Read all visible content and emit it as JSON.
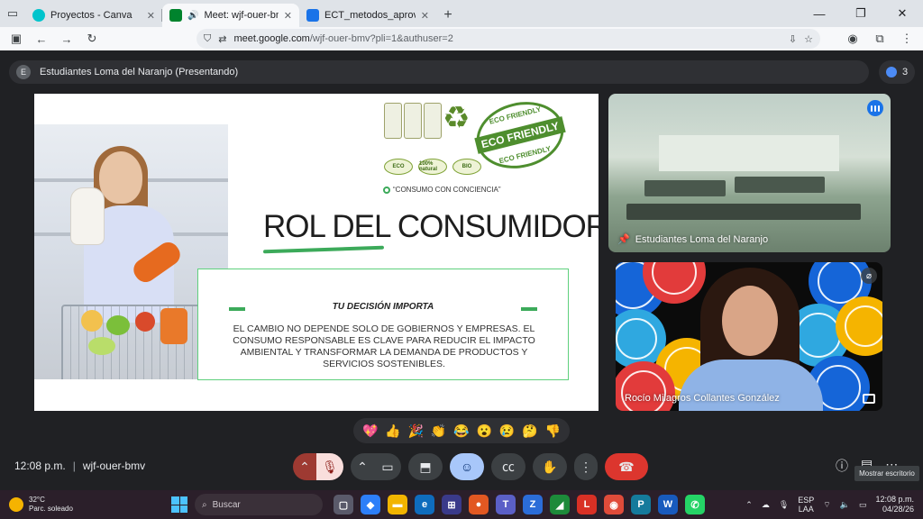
{
  "browser": {
    "tabs": [
      {
        "label": "Proyectos - Canva",
        "icon": "canva-icon",
        "color": "#00c4cc",
        "active": false
      },
      {
        "label": "Meet: wjf-ouer-bmv",
        "icon": "meet-icon",
        "color": "#00832d",
        "active": true
      },
      {
        "label": "ECT_metodos_aprovechar_meta",
        "icon": "docs-icon",
        "color": "#1a73e8",
        "active": false
      }
    ],
    "url_domain": "meet.google.com",
    "url_path": "/wjf-ouer-bmv?pli=1&authuser=2"
  },
  "meet": {
    "presenter_initial": "E",
    "presenter_label": "Estudiantes Loma del Naranjo (Presentando)",
    "participant_count": "3",
    "time": "12:08 p.m.",
    "divider": "|",
    "meeting_code": "wjf-ouer-bmv",
    "tooltip": "Mostrar escritorio"
  },
  "slide": {
    "title": "ROL DEL CONSUMIDOR",
    "eco_stamp": {
      "top": "ECO FRIENDLY",
      "center": "ECO FRIENDLY",
      "bottom": "ECO FRIENDLY"
    },
    "eco_badges": [
      "ECO",
      "100% natural",
      "BIO"
    ],
    "tagline": "“CONSUMO CON CONCIENCIA”",
    "box_heading": "TU DECISIÓN IMPORTA",
    "box_body": "EL CAMBIO NO DEPENDE SOLO DE GOBIERNOS Y EMPRESAS. EL CONSUMO RESPONSABLE ES CLAVE PARA REDUCIR EL IMPACTO AMBIENTAL Y TRANSFORMAR LA DEMANDA DE PRODUCTOS Y SERVICIOS SOSTENIBLES."
  },
  "tiles": {
    "room_name": "Estudiantes Loma del Naranjo",
    "person_name": "Rocío Milagros Collantes González"
  },
  "reactions": [
    "💖",
    "👍",
    "🎉",
    "👏",
    "😂",
    "😮",
    "😢",
    "🤔",
    "👎"
  ],
  "taskbar": {
    "temperature": "32°C",
    "weather": "Parc. soleado",
    "search_placeholder": "Buscar",
    "lang_top": "ESP",
    "lang_bottom": "LAA",
    "clock_time": "12:08 p.m.",
    "clock_date": "04/28/26"
  }
}
